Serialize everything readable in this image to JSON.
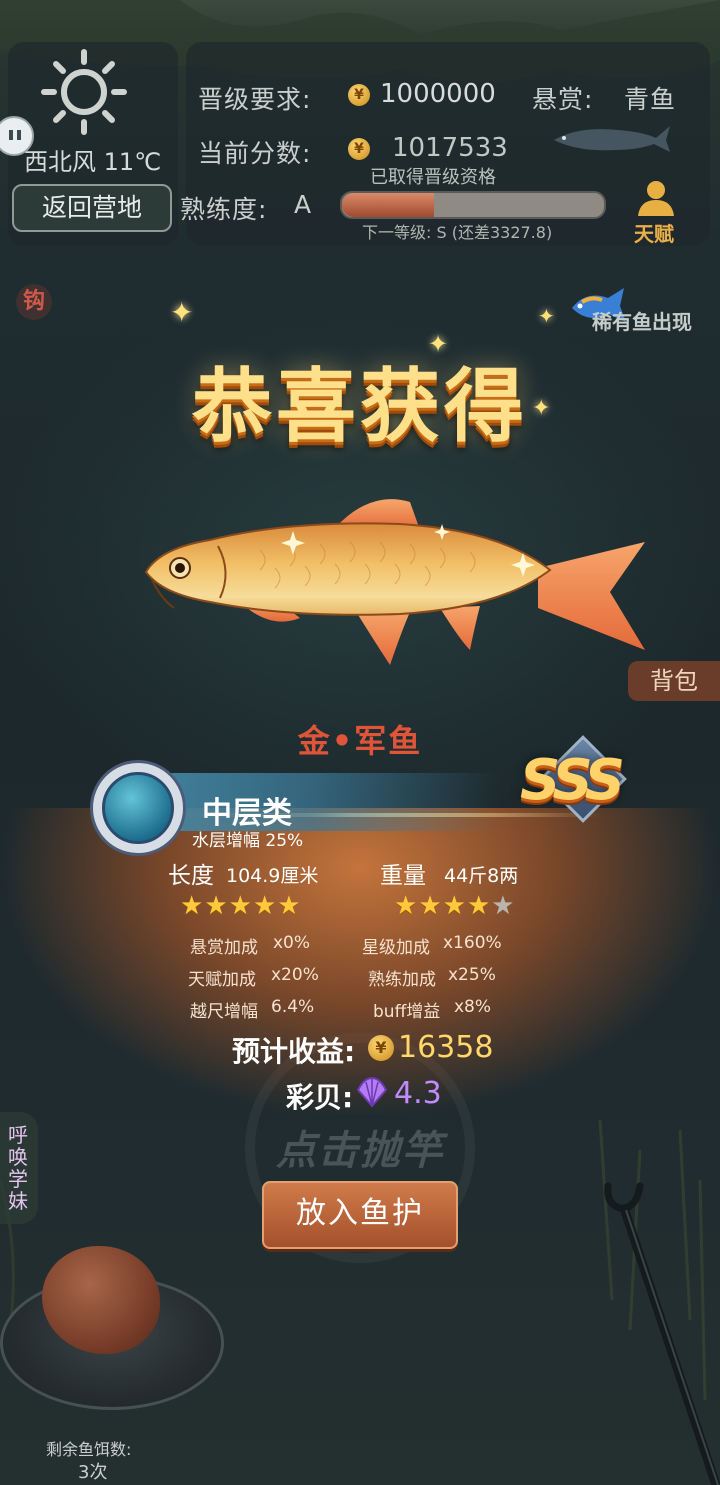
{
  "weather": {
    "icon": "sun-icon",
    "text": "西北风 11℃",
    "return_label": "返回营地"
  },
  "level": {
    "requirement_label": "晋级要求:",
    "requirement_value": "1000000",
    "bounty_label": "悬赏:",
    "bounty_fish": "青鱼",
    "score_label": "当前分数:",
    "score_value": "1017533",
    "qualified_text": "已取得晋级资格",
    "proficiency_label": "熟练度:",
    "proficiency_grade": "A",
    "progress_fraction": 0.35,
    "next_level_text": "下一等级: S (还差3327.8)",
    "talent_label": "天赋"
  },
  "side": {
    "hook_label": "钩",
    "rare_fish_label": "稀有鱼出现",
    "backpack_label": "背包",
    "call_sister_label": "呼唤学妹"
  },
  "result": {
    "title": "恭喜获得",
    "fish_name": "金•军鱼",
    "rank": "SSS",
    "category": "中层类",
    "layer_bonus": "水层增幅 25%",
    "length_label": "长度",
    "length_value": "104.9厘米",
    "length_stars": 5,
    "weight_label": "重量",
    "weight_value": "44斤8两",
    "weight_stars": 4,
    "bonuses": [
      {
        "label": "悬赏加成",
        "value": "x0%"
      },
      {
        "label": "星级加成",
        "value": "x160%"
      },
      {
        "label": "天赋加成",
        "value": "x20%"
      },
      {
        "label": "熟练加成",
        "value": "x25%"
      },
      {
        "label": "越尺增幅",
        "value": "6.4%"
      },
      {
        "label": "buff增益",
        "value": "x8%"
      }
    ],
    "income_label": "预计收益:",
    "income_value": "16358",
    "shell_label": "彩贝:",
    "shell_value": "4.3"
  },
  "actions": {
    "cast_label": "点击抛竿",
    "put_label": "放入鱼护"
  },
  "bait": {
    "remaining_label": "剩余鱼饵数:",
    "remaining_value": "3次"
  },
  "colors": {
    "gold": "#ffe08a",
    "fish_name_red": "#e0553a",
    "income_gold": "#ffd76a",
    "shell_purple": "#c08bff"
  }
}
